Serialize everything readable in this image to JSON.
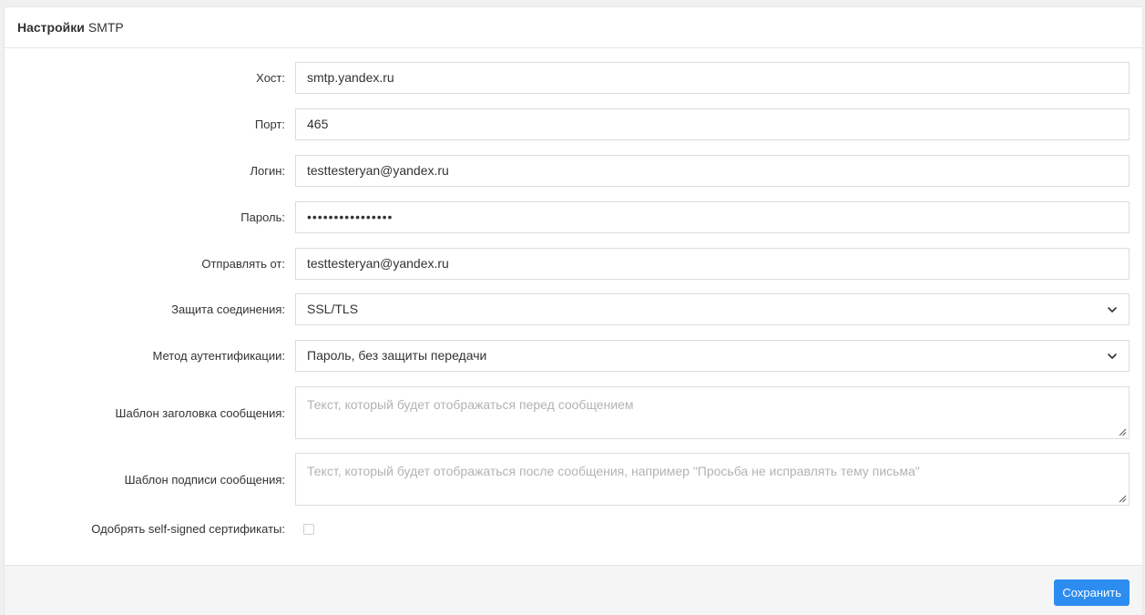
{
  "header": {
    "title_strong": "Настройки",
    "title_rest": "SMTP"
  },
  "form": {
    "host": {
      "label": "Хост:",
      "value": "smtp.yandex.ru"
    },
    "port": {
      "label": "Порт:",
      "value": "465"
    },
    "login": {
      "label": "Логин:",
      "value": "testtesteryan@yandex.ru"
    },
    "password": {
      "label": "Пароль:",
      "value": "••••••••••••••••"
    },
    "send_from": {
      "label": "Отправлять от:",
      "value": "testtesteryan@yandex.ru"
    },
    "connection_security": {
      "label": "Защита соединения:",
      "value": "SSL/TLS"
    },
    "auth_method": {
      "label": "Метод аутентификации:",
      "value": "Пароль, без защиты передачи"
    },
    "header_template": {
      "label": "Шаблон заголовка сообщения:",
      "placeholder": "Текст, который будет отображаться перед сообщением"
    },
    "signature_template": {
      "label": "Шаблон подписи сообщения:",
      "placeholder": "Текст, который будет отображаться после сообщения, например \"Просьба не исправлять тему письма\""
    },
    "self_signed": {
      "label": "Одобрять self-signed сертификаты:",
      "checked": false
    }
  },
  "footer": {
    "save_label": "Сохранить"
  },
  "colors": {
    "accent": "#2d8cf0"
  }
}
